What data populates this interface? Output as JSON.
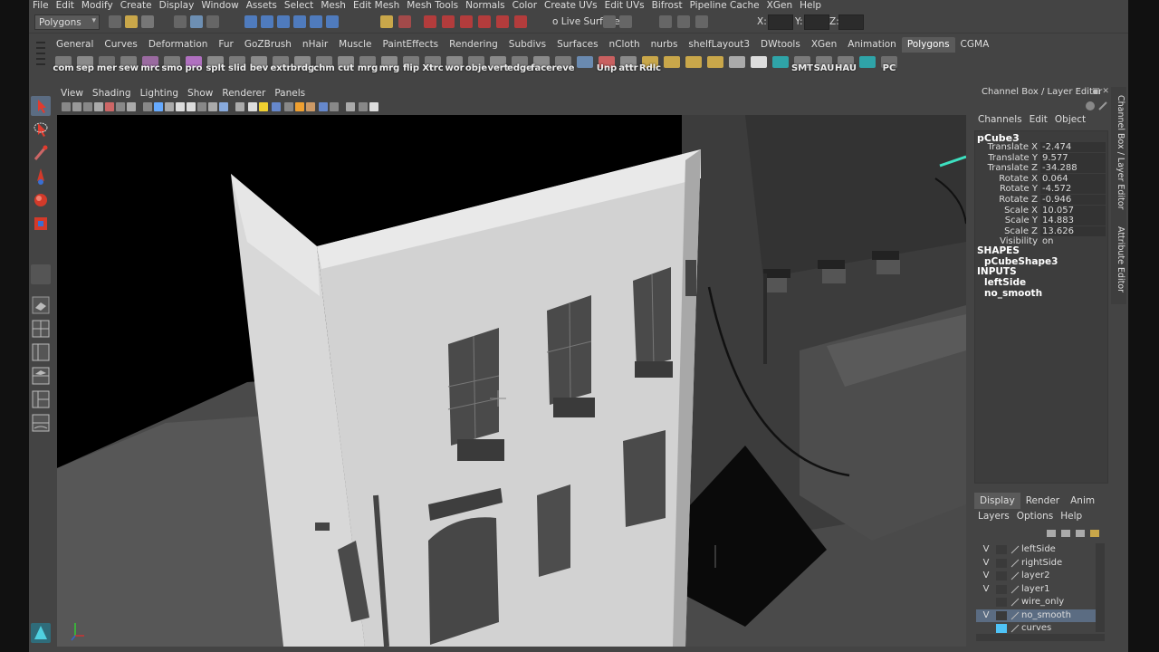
{
  "menubar": [
    "File",
    "Edit",
    "Modify",
    "Create",
    "Display",
    "Window",
    "Assets",
    "Select",
    "Mesh",
    "Edit Mesh",
    "Mesh Tools",
    "Normals",
    "Color",
    "Create UVs",
    "Edit UVs",
    "Bifrost",
    "Pipeline Cache",
    "XGen",
    "Help"
  ],
  "statusline": {
    "mode": "Polygons",
    "live_surface": "o Live Surface",
    "x_label": "X:",
    "y_label": "Y:",
    "z_label": "Z:"
  },
  "shelf_tabs": [
    "General",
    "Curves",
    "Deformation",
    "Fur",
    "GoZBrush",
    "nHair",
    "Muscle",
    "PaintEffects",
    "Rendering",
    "Subdivs",
    "Surfaces",
    "nCloth",
    "nurbs",
    "shelfLayout3",
    "DWtools",
    "XGen",
    "Animation",
    "Polygons",
    "CGMA"
  ],
  "shelf_active": "Polygons",
  "shelf_buttons": [
    "com",
    "sep",
    "mer",
    "sew",
    "mrc",
    "smo",
    "pro",
    "splt",
    "slid",
    "bev",
    "extr",
    "brdg",
    "chm",
    "cut",
    "mrg",
    "mrg",
    "flip",
    "Xtrc",
    "wor",
    "obje",
    "vert",
    "edge",
    "face",
    "reve",
    "",
    "Unp",
    "attr",
    "Rdlc",
    "",
    "",
    "",
    "",
    "",
    "",
    "SMT",
    "SAU",
    "HAU",
    "",
    "PC"
  ],
  "viewport_menu": [
    "View",
    "Shading",
    "Lighting",
    "Show",
    "Renderer",
    "Panels"
  ],
  "channel_box": {
    "title": "Channel Box / Layer Editor",
    "menu": [
      "Channels",
      "Edit",
      "Object"
    ],
    "object": "pCube3",
    "attributes": [
      {
        "name": "Translate X",
        "value": "-2.474"
      },
      {
        "name": "Translate Y",
        "value": "9.577"
      },
      {
        "name": "Translate Z",
        "value": "-34.288"
      },
      {
        "name": "Rotate X",
        "value": "0.064"
      },
      {
        "name": "Rotate Y",
        "value": "-4.572"
      },
      {
        "name": "Rotate Z",
        "value": "-0.946"
      },
      {
        "name": "Scale X",
        "value": "10.057"
      },
      {
        "name": "Scale Y",
        "value": "14.883"
      },
      {
        "name": "Scale Z",
        "value": "13.626"
      },
      {
        "name": "Visibility",
        "value": "on"
      }
    ],
    "shapes_header": "SHAPES",
    "shape": "pCubeShape3",
    "inputs_header": "INPUTS",
    "inputs": [
      "leftSide",
      "no_smooth"
    ]
  },
  "side_tabs": [
    "Channel Box / Layer Editor",
    "Attribute Editor"
  ],
  "layer_editor": {
    "tabs": [
      "Display",
      "Render",
      "Anim"
    ],
    "active_tab": "Display",
    "menu": [
      "Layers",
      "Options",
      "Help"
    ],
    "layers": [
      {
        "visible": "V",
        "name": "leftSide",
        "color": "",
        "selected": false
      },
      {
        "visible": "V",
        "name": "rightSide",
        "color": "",
        "selected": false
      },
      {
        "visible": "V",
        "name": "layer2",
        "color": "",
        "selected": false
      },
      {
        "visible": "V",
        "name": "layer1",
        "color": "",
        "selected": false
      },
      {
        "visible": "",
        "name": "wire_only",
        "color": "",
        "selected": false
      },
      {
        "visible": "V",
        "name": "no_smooth",
        "color": "",
        "selected": true
      },
      {
        "visible": "",
        "name": "curves",
        "color": "#4fc3f7",
        "selected": false
      }
    ]
  },
  "colors": {
    "accent": "#5b6c82",
    "background": "#444444",
    "cyan_edge": "#3de0c0"
  },
  "icons": [
    "select-arrow-icon",
    "lasso-icon",
    "paint-select-icon",
    "move-icon",
    "rotate-icon",
    "scale-icon",
    "axis-gizmo-icon",
    "crosshair-cursor-icon"
  ]
}
